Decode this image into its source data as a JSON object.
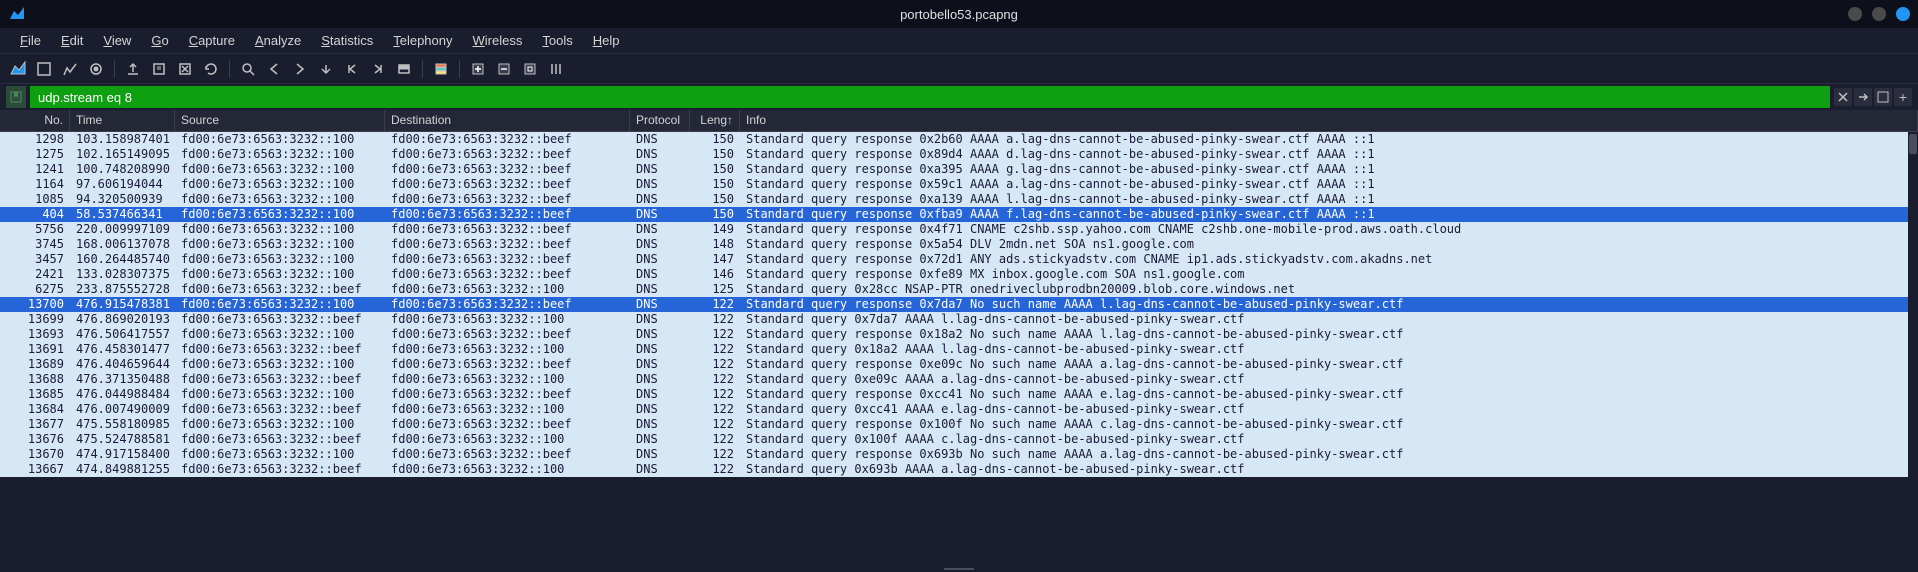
{
  "window": {
    "title": "portobello53.pcapng"
  },
  "menu": {
    "items": [
      "File",
      "Edit",
      "View",
      "Go",
      "Capture",
      "Analyze",
      "Statistics",
      "Telephony",
      "Wireless",
      "Tools",
      "Help"
    ]
  },
  "filter": {
    "value": "udp.stream eq 8"
  },
  "columns": {
    "no": "No.",
    "time": "Time",
    "source": "Source",
    "destination": "Destination",
    "protocol": "Protocol",
    "length": "Leng↑",
    "info": "Info"
  },
  "rows": [
    {
      "no": "1298",
      "time": "103.158987401",
      "src": "fd00:6e73:6563:3232::100",
      "dst": "fd00:6e73:6563:3232::beef",
      "proto": "DNS",
      "len": "150",
      "info": "Standard query response 0x2b60 AAAA a.lag-dns-cannot-be-abused-pinky-swear.ctf AAAA ::1",
      "sel": false
    },
    {
      "no": "1275",
      "time": "102.165149095",
      "src": "fd00:6e73:6563:3232::100",
      "dst": "fd00:6e73:6563:3232::beef",
      "proto": "DNS",
      "len": "150",
      "info": "Standard query response 0x89d4 AAAA d.lag-dns-cannot-be-abused-pinky-swear.ctf AAAA ::1",
      "sel": false
    },
    {
      "no": "1241",
      "time": "100.748208990",
      "src": "fd00:6e73:6563:3232::100",
      "dst": "fd00:6e73:6563:3232::beef",
      "proto": "DNS",
      "len": "150",
      "info": "Standard query response 0xa395 AAAA g.lag-dns-cannot-be-abused-pinky-swear.ctf AAAA ::1",
      "sel": false
    },
    {
      "no": "1164",
      "time": "97.606194044",
      "src": "fd00:6e73:6563:3232::100",
      "dst": "fd00:6e73:6563:3232::beef",
      "proto": "DNS",
      "len": "150",
      "info": "Standard query response 0x59c1 AAAA a.lag-dns-cannot-be-abused-pinky-swear.ctf AAAA ::1",
      "sel": false
    },
    {
      "no": "1085",
      "time": "94.320500939",
      "src": "fd00:6e73:6563:3232::100",
      "dst": "fd00:6e73:6563:3232::beef",
      "proto": "DNS",
      "len": "150",
      "info": "Standard query response 0xa139 AAAA l.lag-dns-cannot-be-abused-pinky-swear.ctf AAAA ::1",
      "sel": false
    },
    {
      "no": "404",
      "time": "58.537466341",
      "src": "fd00:6e73:6563:3232::100",
      "dst": "fd00:6e73:6563:3232::beef",
      "proto": "DNS",
      "len": "150",
      "info": "Standard query response 0xfba9 AAAA f.lag-dns-cannot-be-abused-pinky-swear.ctf AAAA ::1",
      "sel": true
    },
    {
      "no": "5756",
      "time": "220.009997109",
      "src": "fd00:6e73:6563:3232::100",
      "dst": "fd00:6e73:6563:3232::beef",
      "proto": "DNS",
      "len": "149",
      "info": "Standard query response 0x4f71 CNAME c2shb.ssp.yahoo.com CNAME c2shb.one-mobile-prod.aws.oath.cloud",
      "sel": false
    },
    {
      "no": "3745",
      "time": "168.006137078",
      "src": "fd00:6e73:6563:3232::100",
      "dst": "fd00:6e73:6563:3232::beef",
      "proto": "DNS",
      "len": "148",
      "info": "Standard query response 0x5a54 DLV 2mdn.net SOA ns1.google.com",
      "sel": false
    },
    {
      "no": "3457",
      "time": "160.264485740",
      "src": "fd00:6e73:6563:3232::100",
      "dst": "fd00:6e73:6563:3232::beef",
      "proto": "DNS",
      "len": "147",
      "info": "Standard query response 0x72d1 ANY ads.stickyadstv.com CNAME ip1.ads.stickyadstv.com.akadns.net",
      "sel": false
    },
    {
      "no": "2421",
      "time": "133.028307375",
      "src": "fd00:6e73:6563:3232::100",
      "dst": "fd00:6e73:6563:3232::beef",
      "proto": "DNS",
      "len": "146",
      "info": "Standard query response 0xfe89 MX inbox.google.com SOA ns1.google.com",
      "sel": false
    },
    {
      "no": "6275",
      "time": "233.875552728",
      "src": "fd00:6e73:6563:3232::beef",
      "dst": "fd00:6e73:6563:3232::100",
      "proto": "DNS",
      "len": "125",
      "info": "Standard query 0x28cc NSAP-PTR onedriveclubprodbn20009.blob.core.windows.net",
      "sel": false
    },
    {
      "no": "13700",
      "time": "476.915478381",
      "src": "fd00:6e73:6563:3232::100",
      "dst": "fd00:6e73:6563:3232::beef",
      "proto": "DNS",
      "len": "122",
      "info": "Standard query response 0x7da7 No such name AAAA l.lag-dns-cannot-be-abused-pinky-swear.ctf",
      "sel": true
    },
    {
      "no": "13699",
      "time": "476.869020193",
      "src": "fd00:6e73:6563:3232::beef",
      "dst": "fd00:6e73:6563:3232::100",
      "proto": "DNS",
      "len": "122",
      "info": "Standard query 0x7da7 AAAA l.lag-dns-cannot-be-abused-pinky-swear.ctf",
      "sel": false
    },
    {
      "no": "13693",
      "time": "476.506417557",
      "src": "fd00:6e73:6563:3232::100",
      "dst": "fd00:6e73:6563:3232::beef",
      "proto": "DNS",
      "len": "122",
      "info": "Standard query response 0x18a2 No such name AAAA l.lag-dns-cannot-be-abused-pinky-swear.ctf",
      "sel": false
    },
    {
      "no": "13691",
      "time": "476.458301477",
      "src": "fd00:6e73:6563:3232::beef",
      "dst": "fd00:6e73:6563:3232::100",
      "proto": "DNS",
      "len": "122",
      "info": "Standard query 0x18a2 AAAA l.lag-dns-cannot-be-abused-pinky-swear.ctf",
      "sel": false
    },
    {
      "no": "13689",
      "time": "476.404659644",
      "src": "fd00:6e73:6563:3232::100",
      "dst": "fd00:6e73:6563:3232::beef",
      "proto": "DNS",
      "len": "122",
      "info": "Standard query response 0xe09c No such name AAAA a.lag-dns-cannot-be-abused-pinky-swear.ctf",
      "sel": false
    },
    {
      "no": "13688",
      "time": "476.371350488",
      "src": "fd00:6e73:6563:3232::beef",
      "dst": "fd00:6e73:6563:3232::100",
      "proto": "DNS",
      "len": "122",
      "info": "Standard query 0xe09c AAAA a.lag-dns-cannot-be-abused-pinky-swear.ctf",
      "sel": false
    },
    {
      "no": "13685",
      "time": "476.044988484",
      "src": "fd00:6e73:6563:3232::100",
      "dst": "fd00:6e73:6563:3232::beef",
      "proto": "DNS",
      "len": "122",
      "info": "Standard query response 0xcc41 No such name AAAA e.lag-dns-cannot-be-abused-pinky-swear.ctf",
      "sel": false
    },
    {
      "no": "13684",
      "time": "476.007490009",
      "src": "fd00:6e73:6563:3232::beef",
      "dst": "fd00:6e73:6563:3232::100",
      "proto": "DNS",
      "len": "122",
      "info": "Standard query 0xcc41 AAAA e.lag-dns-cannot-be-abused-pinky-swear.ctf",
      "sel": false
    },
    {
      "no": "13677",
      "time": "475.558180985",
      "src": "fd00:6e73:6563:3232::100",
      "dst": "fd00:6e73:6563:3232::beef",
      "proto": "DNS",
      "len": "122",
      "info": "Standard query response 0x100f No such name AAAA c.lag-dns-cannot-be-abused-pinky-swear.ctf",
      "sel": false
    },
    {
      "no": "13676",
      "time": "475.524788581",
      "src": "fd00:6e73:6563:3232::beef",
      "dst": "fd00:6e73:6563:3232::100",
      "proto": "DNS",
      "len": "122",
      "info": "Standard query 0x100f AAAA c.lag-dns-cannot-be-abused-pinky-swear.ctf",
      "sel": false
    },
    {
      "no": "13670",
      "time": "474.917158400",
      "src": "fd00:6e73:6563:3232::100",
      "dst": "fd00:6e73:6563:3232::beef",
      "proto": "DNS",
      "len": "122",
      "info": "Standard query response 0x693b No such name AAAA a.lag-dns-cannot-be-abused-pinky-swear.ctf",
      "sel": false
    },
    {
      "no": "13667",
      "time": "474.849881255",
      "src": "fd00:6e73:6563:3232::beef",
      "dst": "fd00:6e73:6563:3232::100",
      "proto": "DNS",
      "len": "122",
      "info": "Standard query 0x693b AAAA a.lag-dns-cannot-be-abused-pinky-swear.ctf",
      "sel": false
    }
  ]
}
